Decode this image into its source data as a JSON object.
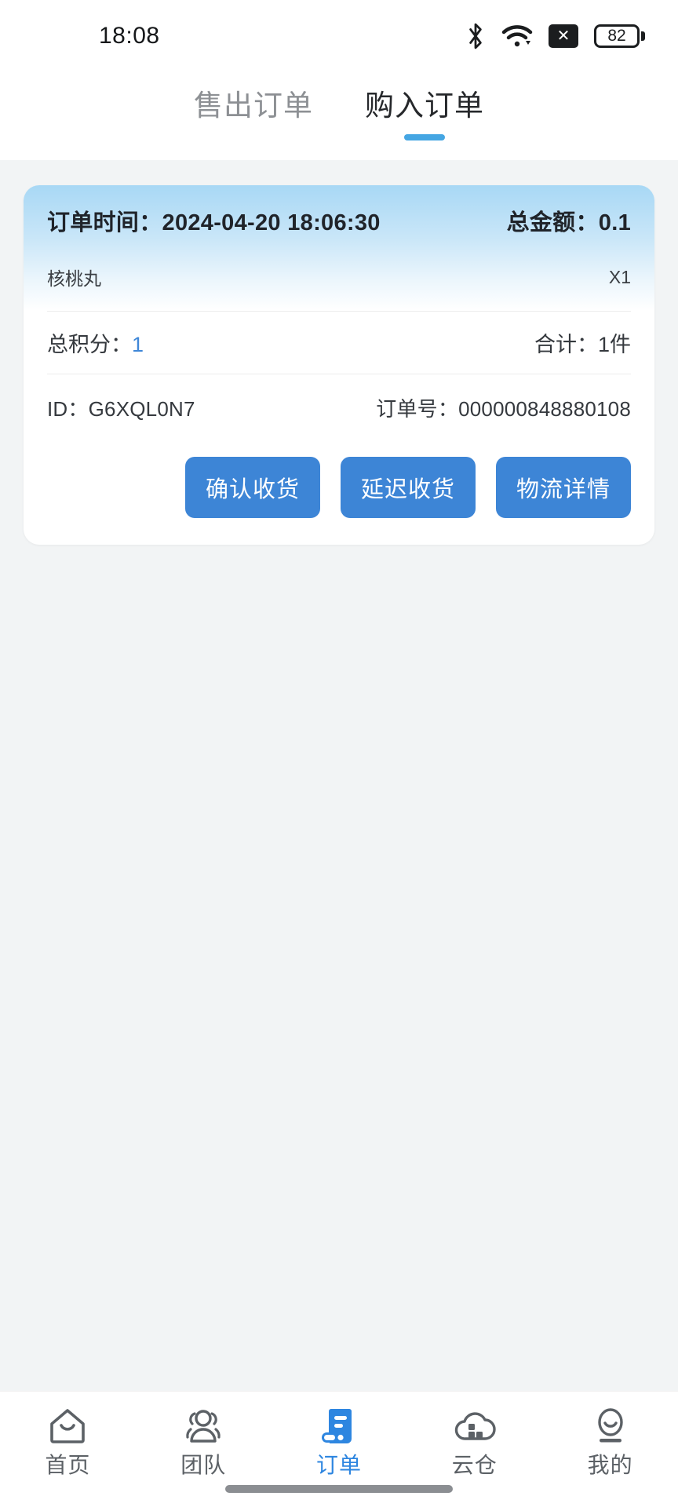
{
  "statusbar": {
    "time": "18:08",
    "bluetooth_icon": "bluetooth-icon",
    "wifi_icon": "wifi-icon",
    "nosim_icon": "no-sim-icon",
    "nosim_glyph": "✕",
    "battery_level": "82"
  },
  "tabs": [
    {
      "label": "售出订单",
      "active": false
    },
    {
      "label": "购入订单",
      "active": true
    }
  ],
  "order": {
    "time_label": "订单时间：",
    "time_value": "2024-04-20 18:06:30",
    "amount_label": "总金额：",
    "amount_value": "0.1",
    "product_name": "核桃丸",
    "product_qty": "X1",
    "points_label": "总积分：",
    "points_value": "1",
    "total_label": "合计：",
    "total_value": "1件",
    "id_label": "ID：",
    "id_value": "G6XQL0N7",
    "orderno_label": "订单号：",
    "orderno_value": "000000848880108",
    "buttons": [
      {
        "label": "确认收货",
        "name": "confirm-receipt-button"
      },
      {
        "label": "延迟收货",
        "name": "delay-receipt-button"
      },
      {
        "label": "物流详情",
        "name": "logistics-detail-button"
      }
    ]
  },
  "bottomnav": [
    {
      "label": "首页",
      "icon": "home-icon",
      "active": false
    },
    {
      "label": "团队",
      "icon": "team-icon",
      "active": false
    },
    {
      "label": "订单",
      "icon": "orders-icon",
      "active": true
    },
    {
      "label": "云仓",
      "icon": "cloud-warehouse-icon",
      "active": false
    },
    {
      "label": "我的",
      "icon": "profile-icon",
      "active": false
    }
  ],
  "colors": {
    "accent_blue": "#3d85d6",
    "tab_indicator": "#45a6e3",
    "nav_active": "#2e86e0",
    "card_gradient_top": "#a8d8f5",
    "page_bg": "#f2f4f5"
  }
}
